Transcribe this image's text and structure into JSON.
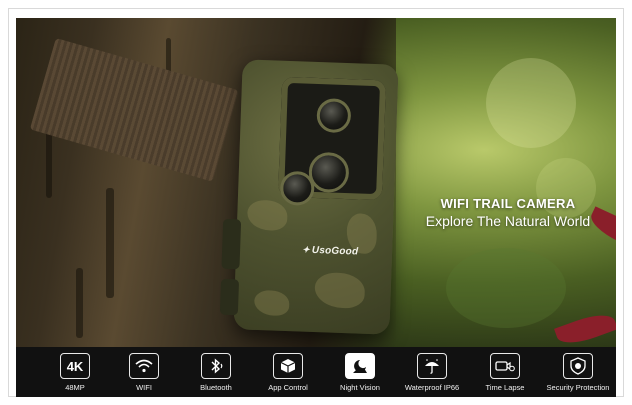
{
  "hero": {
    "title": "WIFI TRAIL CAMERA",
    "subtitle": "Explore The Natural World",
    "brand_logo": "UsoGood"
  },
  "features": [
    {
      "icon": "4k-icon",
      "glyph": "4K",
      "label": "48MP"
    },
    {
      "icon": "wifi-icon",
      "glyph": "((·))",
      "label": "WIFI"
    },
    {
      "icon": "bluetooth-icon",
      "glyph": "ᛒ",
      "label": "Bluetooth"
    },
    {
      "icon": "app-control-icon",
      "glyph": "⬢",
      "label": "App Control"
    },
    {
      "icon": "night-vision-icon",
      "glyph": "☾",
      "label": "Night Vision"
    },
    {
      "icon": "waterproof-icon",
      "glyph": "☂",
      "label": "Waterproof IP66"
    },
    {
      "icon": "time-lapse-icon",
      "glyph": "▭◷",
      "label": "Time Lapse"
    },
    {
      "icon": "security-icon",
      "glyph": "⛨",
      "label": "Security Protection"
    }
  ]
}
